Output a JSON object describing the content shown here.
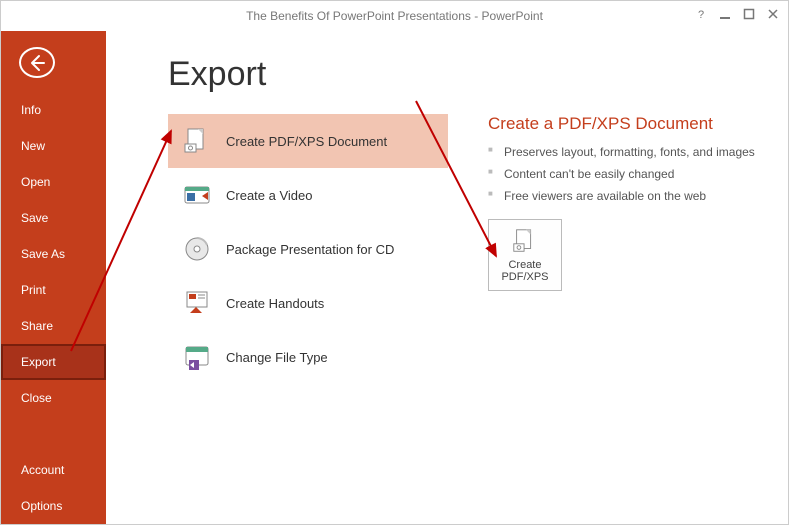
{
  "window": {
    "title": "The Benefits Of PowerPoint Presentations - PowerPoint"
  },
  "sidebar": {
    "items": [
      {
        "label": "Info"
      },
      {
        "label": "New"
      },
      {
        "label": "Open"
      },
      {
        "label": "Save"
      },
      {
        "label": "Save As"
      },
      {
        "label": "Print"
      },
      {
        "label": "Share"
      },
      {
        "label": "Export"
      },
      {
        "label": "Close"
      }
    ],
    "footer": [
      {
        "label": "Account"
      },
      {
        "label": "Options"
      }
    ]
  },
  "main": {
    "heading": "Export",
    "options": [
      {
        "label": "Create PDF/XPS Document"
      },
      {
        "label": "Create a Video"
      },
      {
        "label": "Package Presentation for CD"
      },
      {
        "label": "Create Handouts"
      },
      {
        "label": "Change File Type"
      }
    ],
    "detail": {
      "title": "Create a PDF/XPS Document",
      "bullets": [
        "Preserves layout, formatting, fonts, and images",
        "Content can't be easily changed",
        "Free viewers are available on the web"
      ],
      "button_line1": "Create",
      "button_line2": "PDF/XPS"
    }
  }
}
